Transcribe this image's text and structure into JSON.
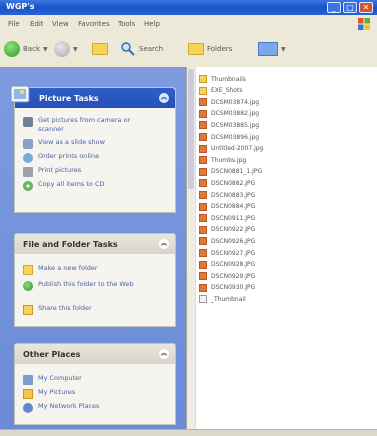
{
  "window": {
    "title": "WGP's"
  },
  "menu": [
    "File",
    "Edit",
    "View",
    "Favorites",
    "Tools",
    "Help"
  ],
  "toolbar": {
    "back": "Back",
    "search": "Search",
    "folders": "Folders"
  },
  "picture_tasks": {
    "title": "Picture Tasks",
    "items": [
      "Get pictures from camera or scanner",
      "View as a slide show",
      "Order prints online",
      "Print pictures",
      "Copy all items to CD"
    ]
  },
  "file_folder_tasks": {
    "title": "File and Folder Tasks",
    "items": [
      "Make a new folder",
      "Publish this folder to the Web",
      "Share this folder"
    ]
  },
  "other_places": {
    "title": "Other Places",
    "items": [
      "My Computer",
      "My Pictures",
      "My Network Places"
    ]
  },
  "files": [
    {
      "name": "Thumbnails",
      "kind": "folder"
    },
    {
      "name": "EXE_Shots",
      "kind": "folder"
    },
    {
      "name": "DCSM03874.jpg",
      "kind": "image"
    },
    {
      "name": "DCSM03882.jpg",
      "kind": "image"
    },
    {
      "name": "DCSM03885.jpg",
      "kind": "image"
    },
    {
      "name": "DCSM03896.jpg",
      "kind": "image"
    },
    {
      "name": "Untitled-2007.jpg",
      "kind": "image"
    },
    {
      "name": "Thumbs.jpg",
      "kind": "image"
    },
    {
      "name": "DSCN0881_1.JPG",
      "kind": "image"
    },
    {
      "name": "DSCN0882.JPG",
      "kind": "image"
    },
    {
      "name": "DSCN0883.JPG",
      "kind": "image"
    },
    {
      "name": "DSCN0884.JPG",
      "kind": "image"
    },
    {
      "name": "DSCN0911.JPG",
      "kind": "image"
    },
    {
      "name": "DSCN0922.JPG",
      "kind": "image"
    },
    {
      "name": "DSCN0926.JPG",
      "kind": "image"
    },
    {
      "name": "DSCN0927.JPG",
      "kind": "image"
    },
    {
      "name": "DSCN0928.JPG",
      "kind": "image"
    },
    {
      "name": "DSCN0929.JPG",
      "kind": "image"
    },
    {
      "name": "DSCN0930.JPG",
      "kind": "image"
    },
    {
      "name": "_Thumbnail",
      "kind": "file"
    }
  ],
  "colors": {
    "titlebar": "#1a52c8",
    "taskpane": "#7e9be0",
    "link": "#4a5fa8"
  }
}
